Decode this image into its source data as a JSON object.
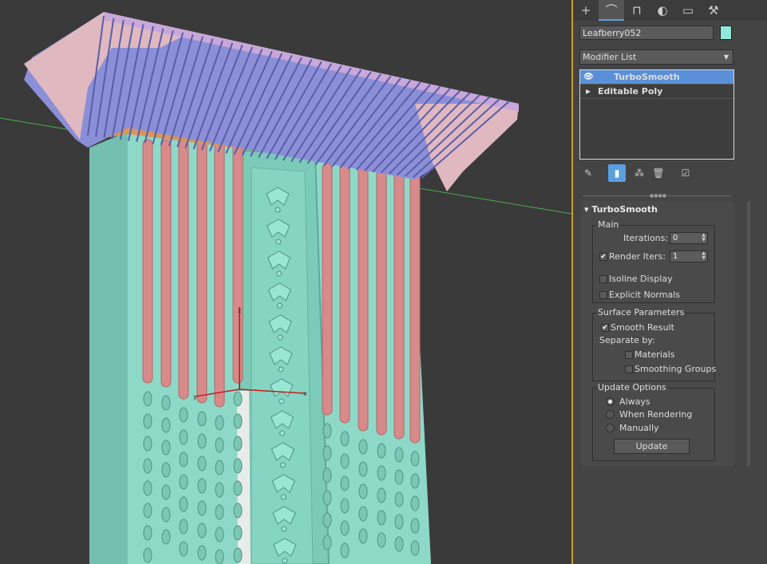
{
  "command_panel": {
    "tabs": [
      {
        "icon": "create-icon",
        "glyph": "+"
      },
      {
        "icon": "modify-icon",
        "glyph": "⌒"
      },
      {
        "icon": "hierarchy-icon",
        "glyph": "⊓"
      },
      {
        "icon": "motion-icon",
        "glyph": "◐"
      },
      {
        "icon": "display-icon",
        "glyph": "▭"
      },
      {
        "icon": "utilities-icon",
        "glyph": "⚒"
      }
    ],
    "object_name": "Leafberry052",
    "object_color": "#8fe8d8",
    "modifier_list_label": "Modifier List",
    "stack": [
      {
        "label": "TurboSmooth",
        "selected": true,
        "icon": "eye-icon"
      },
      {
        "label": "Editable Poly",
        "selected": false,
        "icon": "expand-triangle-icon"
      }
    ]
  },
  "turbosmooth": {
    "title": "TurboSmooth",
    "main_group": "Main",
    "iterations_label": "Iterations:",
    "iterations_value": "0",
    "render_iters_label": "Render Iters:",
    "render_iters_value": "1",
    "render_iters_checked": true,
    "isoline_label": "Isoline Display",
    "isoline_checked": false,
    "explicit_normals_label": "Explicit Normals",
    "explicit_normals_checked": false,
    "surface_group": "Surface Parameters",
    "smooth_result_label": "Smooth Result",
    "smooth_result_checked": true,
    "separate_by_label": "Separate by:",
    "materials_label": "Materials",
    "materials_checked": false,
    "smoothing_groups_label": "Smoothing Groups",
    "smoothing_groups_checked": false,
    "update_group": "Update Options",
    "update_options": [
      "Always",
      "When Rendering",
      "Manually"
    ],
    "update_selected": "Always",
    "update_button": "Update"
  },
  "gizmo": {
    "x_label": "x",
    "y_label": "y",
    "z_label": "z"
  },
  "colors": {
    "viewport_bg": "#3a3a3a",
    "pillar": "#8ed8c8",
    "flute": "#d88a8a",
    "capital_blue": "#8b8fd8",
    "capital_pink": "#e0b8c0",
    "band": "#d8955a",
    "viewport_border": "#c8a020",
    "selection": "#5a90d8"
  }
}
